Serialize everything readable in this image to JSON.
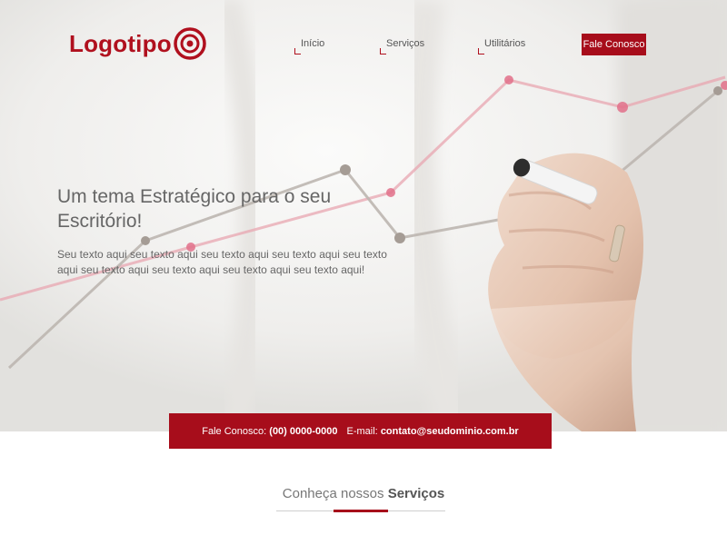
{
  "header": {
    "logo_text": "Logotipo",
    "nav": [
      "Início",
      "Serviços",
      "Utilitários"
    ],
    "cta_label": "Fale Conosco"
  },
  "hero": {
    "headline": "Um tema Estratégico para o seu Escritório!",
    "subtext": "Seu texto aqui seu texto aqui seu texto aqui seu texto aqui seu texto aqui seu texto aqui seu texto aqui seu texto aqui seu texto aqui!"
  },
  "contact_bar": {
    "phone_label": "Fale Conosco:",
    "phone": "(00) 0000-0000",
    "email_label": "E-mail:",
    "email": "contato@seudominio.com.br"
  },
  "services": {
    "title_prefix": "Conheça nossos",
    "title_bold": "Serviços"
  },
  "colors": {
    "brand_red": "#a70d1b",
    "text_gray": "#666666"
  },
  "icons": [
    "target-logo-icon"
  ]
}
